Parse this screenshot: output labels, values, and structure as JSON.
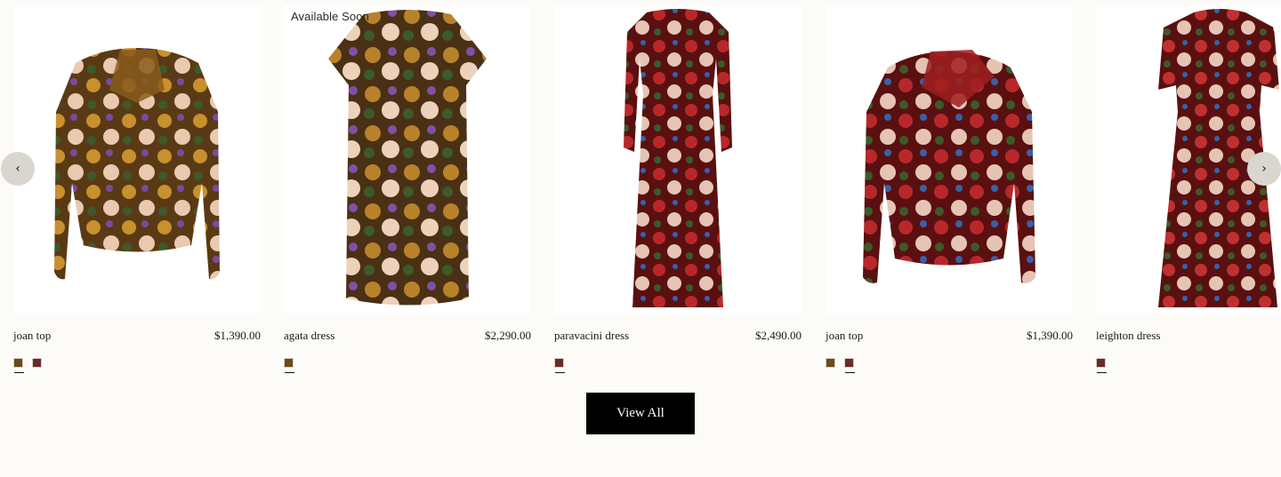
{
  "colors": {
    "background": "#fcfbf8",
    "card_bg": "#ffffff",
    "button_bg": "#000000",
    "button_text": "#ffffff",
    "arrow_bg": "#d9d6d0",
    "print_gold": "#8a5a1c",
    "print_red": "#9a1c1c"
  },
  "carousel": {
    "prev_icon": "chevron-left-icon",
    "next_icon": "chevron-right-icon",
    "products": [
      {
        "badge": "",
        "name": "joan top",
        "price": "$1,390.00",
        "garment": "top",
        "print": "gold",
        "swatches": [
          {
            "color": "#6b4a1c",
            "active": true
          },
          {
            "color": "#6b2a2a",
            "active": false
          }
        ]
      },
      {
        "badge": "Available Soon",
        "name": "agata dress",
        "price": "$2,290.00",
        "garment": "short-dress",
        "print": "gold",
        "swatches": [
          {
            "color": "#6b4a1c",
            "active": true
          }
        ]
      },
      {
        "badge": "",
        "name": "paravacini dress",
        "price": "$2,490.00",
        "garment": "long-dress",
        "print": "red",
        "swatches": [
          {
            "color": "#6b2a2a",
            "active": true
          }
        ]
      },
      {
        "badge": "",
        "name": "joan top",
        "price": "$1,390.00",
        "garment": "top",
        "print": "red",
        "swatches": [
          {
            "color": "#6b4a1c",
            "active": false
          },
          {
            "color": "#6b2a2a",
            "active": true
          }
        ]
      },
      {
        "badge": "",
        "name": "leighton dress",
        "price": "",
        "garment": "shirt-dress",
        "print": "red",
        "swatches": [
          {
            "color": "#6b2a2a",
            "active": true
          }
        ]
      }
    ]
  },
  "view_all_label": "View All"
}
